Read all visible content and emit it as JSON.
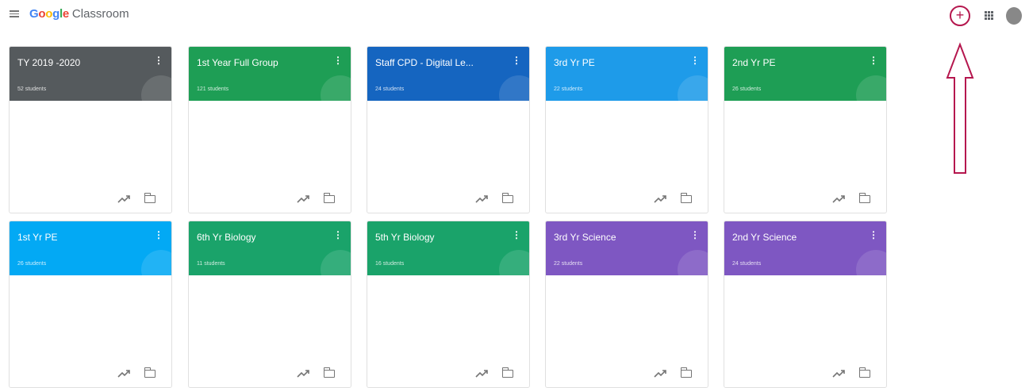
{
  "header": {
    "brand_google": "Google",
    "brand_product": "Classroom"
  },
  "colors": {
    "accent_annotation": "#b5174e",
    "grey": "#555a5d",
    "green": "#1e9e55",
    "blue": "#1565c0",
    "light_blue": "#1e9be9",
    "cyan": "#03a9f4",
    "teal": "#1aa36a",
    "purple": "#7e57c2"
  },
  "classes": [
    {
      "title": "TY 2019 -2020",
      "students": "52 students",
      "color": "grey"
    },
    {
      "title": "1st Year Full Group",
      "students": "121 students",
      "color": "green"
    },
    {
      "title": "Staff CPD - Digital Le...",
      "students": "24 students",
      "color": "blue"
    },
    {
      "title": "3rd Yr PE",
      "students": "22 students",
      "color": "light_blue"
    },
    {
      "title": "2nd Yr PE",
      "students": "26 students",
      "color": "green"
    },
    {
      "title": "1st Yr PE",
      "students": "26 students",
      "color": "cyan"
    },
    {
      "title": "6th Yr Biology",
      "students": "11 students",
      "color": "teal"
    },
    {
      "title": "5th Yr Biology",
      "students": "16 students",
      "color": "teal"
    },
    {
      "title": "3rd Yr Science",
      "students": "22 students",
      "color": "purple"
    },
    {
      "title": "2nd Yr Science",
      "students": "24 students",
      "color": "purple"
    }
  ],
  "icons": {
    "menu": "menu-icon",
    "add": "add-icon",
    "apps": "apps-icon",
    "account": "avatar",
    "trend": "trending-icon",
    "folder": "folder-icon",
    "more": "more-vert-icon"
  }
}
